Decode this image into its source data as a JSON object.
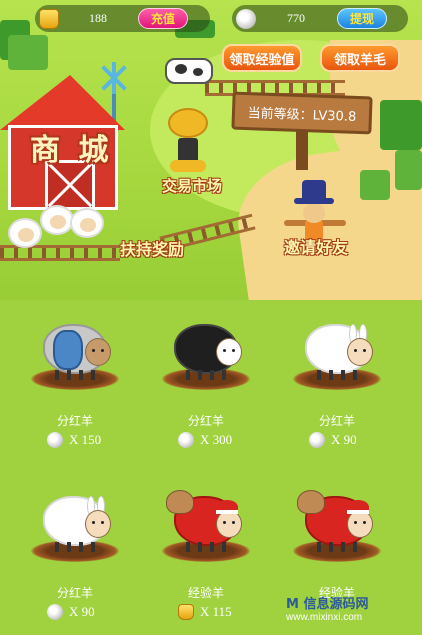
{
  "currency": {
    "gold": {
      "amount": "188",
      "icon": "gold-ingot-icon",
      "button_label": "充值"
    },
    "diamond": {
      "amount": "770",
      "icon": "diamond-icon",
      "button_label": "提现"
    }
  },
  "actions": {
    "claim_exp": "领取经验值",
    "claim_wool": "领取羊毛"
  },
  "scene": {
    "shop_label": "商 城",
    "level_text": "当前等级：LV30.8",
    "market_label": "交易市场",
    "support_label": "扶持奖励",
    "invite_label": "邀请好友"
  },
  "cards": [
    {
      "name": "分红羊",
      "price": "X 150",
      "currency": "diamond"
    },
    {
      "name": "分红羊",
      "price": "X 300",
      "currency": "diamond"
    },
    {
      "name": "分红羊",
      "price": "X 90",
      "currency": "diamond"
    },
    {
      "name": "分红羊",
      "price": "X 90",
      "currency": "diamond"
    },
    {
      "name": "经验羊",
      "price": "X 115",
      "currency": "gold"
    },
    {
      "name": "经验羊",
      "price": "",
      "currency": "none"
    }
  ],
  "watermark": {
    "title": "M 信息源码网",
    "url": "www.mixinxi.com"
  }
}
